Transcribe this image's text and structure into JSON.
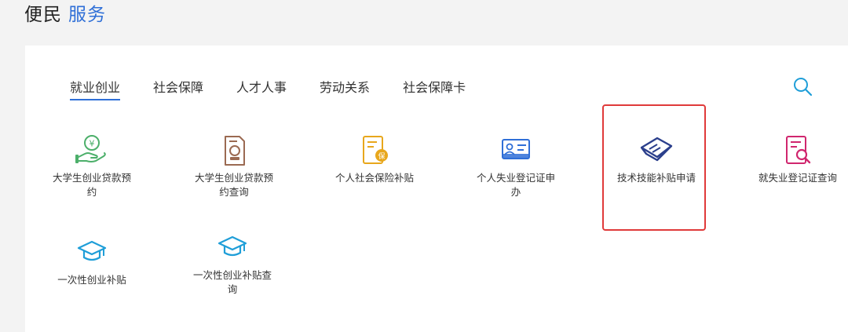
{
  "header": {
    "title_plain": "便民",
    "title_accent": "服务"
  },
  "tabs": [
    {
      "label": "就业创业",
      "active": true
    },
    {
      "label": "社会保障",
      "active": false
    },
    {
      "label": "人才人事",
      "active": false
    },
    {
      "label": "劳动关系",
      "active": false
    },
    {
      "label": "社会保障卡",
      "active": false
    }
  ],
  "search": {
    "icon": "search-icon"
  },
  "services": [
    {
      "label": "大学生创业贷款预约",
      "icon": "hand-yen-icon"
    },
    {
      "label": "大学生创业贷款预约查询",
      "icon": "document-stamp-icon"
    },
    {
      "label": "个人社会保险补贴",
      "icon": "insurance-document-icon"
    },
    {
      "label": "个人失业登记证申办",
      "icon": "id-card-icon"
    },
    {
      "label": "技术技能补贴申请",
      "icon": "handshake-card-icon",
      "highlighted": true
    },
    {
      "label": "就失业登记证查询",
      "icon": "document-search-icon"
    },
    {
      "label": "一次性创业补贴",
      "icon": "graduation-cap-icon"
    },
    {
      "label": "一次性创业补贴查询",
      "icon": "graduation-cap-icon"
    }
  ],
  "colors": {
    "accent": "#2f6fd7",
    "highlight_border": "#e03a3a",
    "icon_green": "#4caf6a",
    "icon_brown": "#9b6a52",
    "icon_gold": "#e8a71c",
    "icon_blue": "#2f6fd7",
    "icon_navy": "#2b3f8c",
    "icon_magenta": "#d0266e",
    "icon_cyan": "#1f9ed8"
  }
}
